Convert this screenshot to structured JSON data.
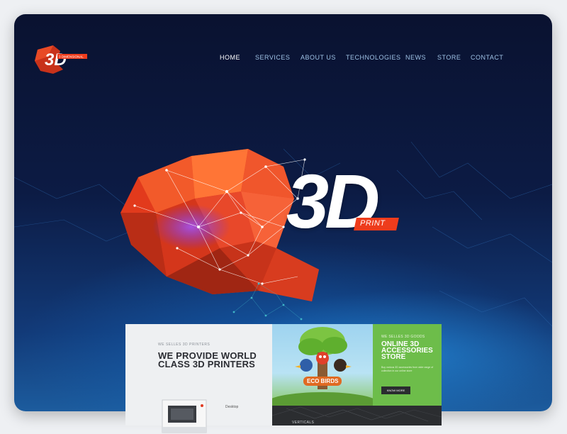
{
  "brand": {
    "logo_text": "3D",
    "logo_tagline": "3 DIMENSIONAL",
    "colors": {
      "accent": "#ee3c1c",
      "nav": "#9fc3e6",
      "nav_active": "#ffffff"
    }
  },
  "nav": {
    "items": [
      {
        "label": "HOME",
        "active": true
      },
      {
        "label": "SERVICES"
      },
      {
        "label": "ABOUT US"
      },
      {
        "label": "TECHNOLOGIES"
      },
      {
        "label": "NEWS"
      },
      {
        "label": "STORE"
      },
      {
        "label": "CONTACT"
      }
    ]
  },
  "hero": {
    "logo_text": "3D",
    "badge": "PRINT",
    "graphic": "red-polygon-brain-network-icon"
  },
  "preview": {
    "left": {
      "kicker": "WE SELLES 3D PRINTERS",
      "title": "WE PROVIDE WORLD CLASS 3D PRINTERS",
      "printer_label": "Desktop",
      "printer_icon": "3d-printer-icon"
    },
    "middle": {
      "badge": "ECO BIRDS",
      "illustration": "cartoon-birds-tree-icon"
    },
    "right": {
      "kicker": "WE SELLES 3D GOODS",
      "title": "ONLINE 3D ACCESSORIES STORE",
      "desc": "Buy various 3D accessories from wide range of collection in our online store",
      "button": "KNOW MORE"
    },
    "bottom": {
      "label": "VERTICALS"
    }
  }
}
